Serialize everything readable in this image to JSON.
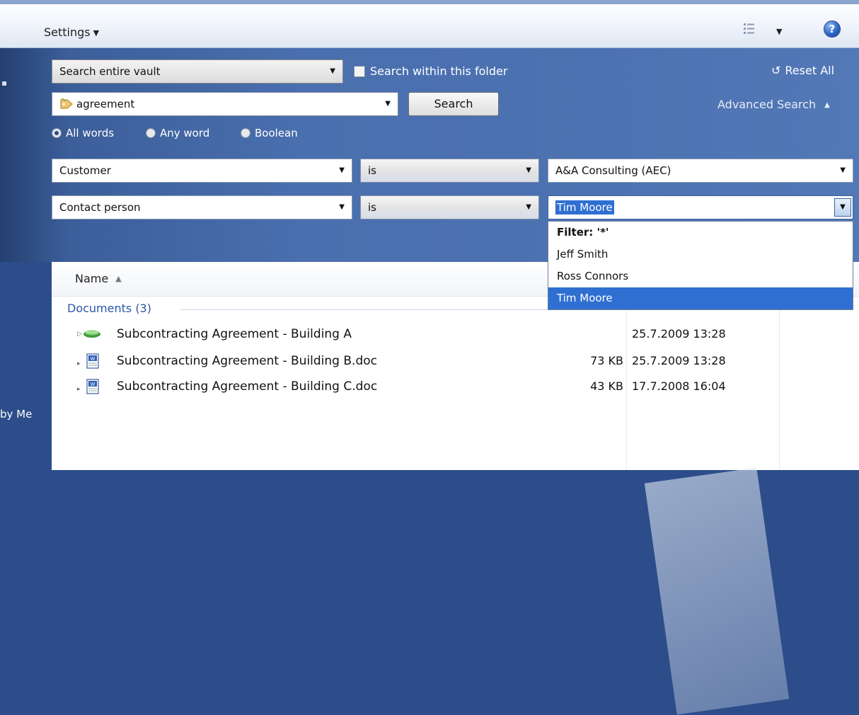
{
  "toolbar": {
    "settings_label": "Settings",
    "help_label": "?"
  },
  "search": {
    "scope_value": "Search entire vault",
    "within_folder_label": "Search within this folder",
    "within_folder_checked": false,
    "query_value": "agreement",
    "search_button_label": "Search",
    "reset_label": "Reset All",
    "advanced_label": "Advanced Search",
    "modes": [
      {
        "label": "All words",
        "selected": true
      },
      {
        "label": "Any word",
        "selected": false
      },
      {
        "label": "Boolean",
        "selected": false
      }
    ]
  },
  "conditions": [
    {
      "property": "Customer",
      "operator": "is",
      "value": "A&A Consulting (AEC)"
    },
    {
      "property": "Contact person",
      "operator": "is",
      "value": "Tim Moore"
    }
  ],
  "dropdown": {
    "filter_label": "Filter: '*'",
    "options": [
      "Jeff Smith",
      "Ross Connors",
      "Tim Moore"
    ],
    "highlighted": "Tim Moore"
  },
  "list": {
    "name_column": "Name",
    "group_label": "Documents (3)",
    "rows": [
      {
        "name": "Subcontracting Agreement - Building A",
        "size": "",
        "date": "25.7.2009 13:28",
        "icon": "document-collection-icon"
      },
      {
        "name": "Subcontracting Agreement - Building B.doc",
        "size": "73 KB",
        "date": "25.7.2009 13:28",
        "icon": "word-document-icon"
      },
      {
        "name": "Subcontracting Agreement - Building C.doc",
        "size": "43 KB",
        "date": "17.7.2008 16:04",
        "icon": "word-document-icon"
      }
    ]
  },
  "side": {
    "by_me_label": "by Me"
  },
  "colors": {
    "panel": "#4a6fae",
    "selection": "#2f6fd1",
    "group_text": "#2b56a6"
  }
}
